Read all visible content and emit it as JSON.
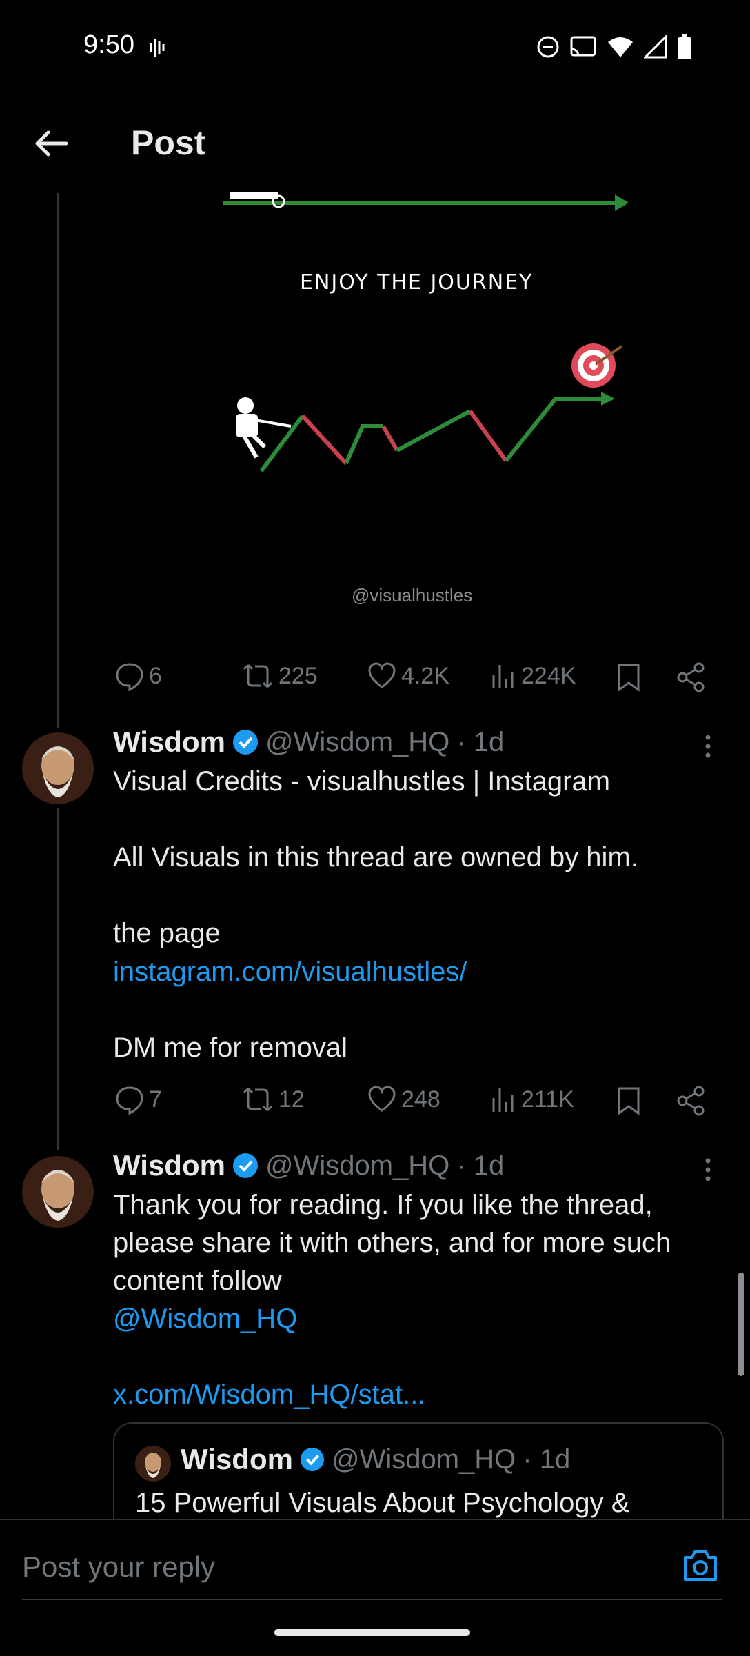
{
  "status_bar": {
    "time": "9:50"
  },
  "header": {
    "title": "Post"
  },
  "image": {
    "caption": "ENJOY THE JOURNEY",
    "watermark": "@visualhustles"
  },
  "tweet0_actions": {
    "replies": "6",
    "reposts": "225",
    "likes": "4.2K",
    "views": "224K"
  },
  "tweet1": {
    "name": "Wisdom",
    "handle": "@Wisdom_HQ",
    "time": "· 1d",
    "line1": "Visual Credits - visualhustles | Instagram",
    "line2": "All Visuals in this thread are owned by him.",
    "line3": "the page",
    "link": "instagram.com/visualhustles/",
    "line4": "DM me for removal",
    "actions": {
      "replies": "7",
      "reposts": "12",
      "likes": "248",
      "views": "211K"
    }
  },
  "tweet2": {
    "name": "Wisdom",
    "handle": "@Wisdom_HQ",
    "time": "· 1d",
    "line1": "Thank you for reading. If you like the thread,",
    "line2": "please share it with others, and for more such",
    "line3": "content follow",
    "mention": "@Wisdom_HQ",
    "link": "x.com/Wisdom_HQ/stat...",
    "quote": {
      "name": "Wisdom",
      "handle": "@Wisdom_HQ",
      "time": "· 1d",
      "text": "15 Powerful Visuals About Psychology &"
    }
  },
  "reply": {
    "placeholder": "Post your reply"
  },
  "colors": {
    "accent": "#1d9bf0",
    "muted": "#71767b",
    "verified": "#1d9bf0"
  }
}
